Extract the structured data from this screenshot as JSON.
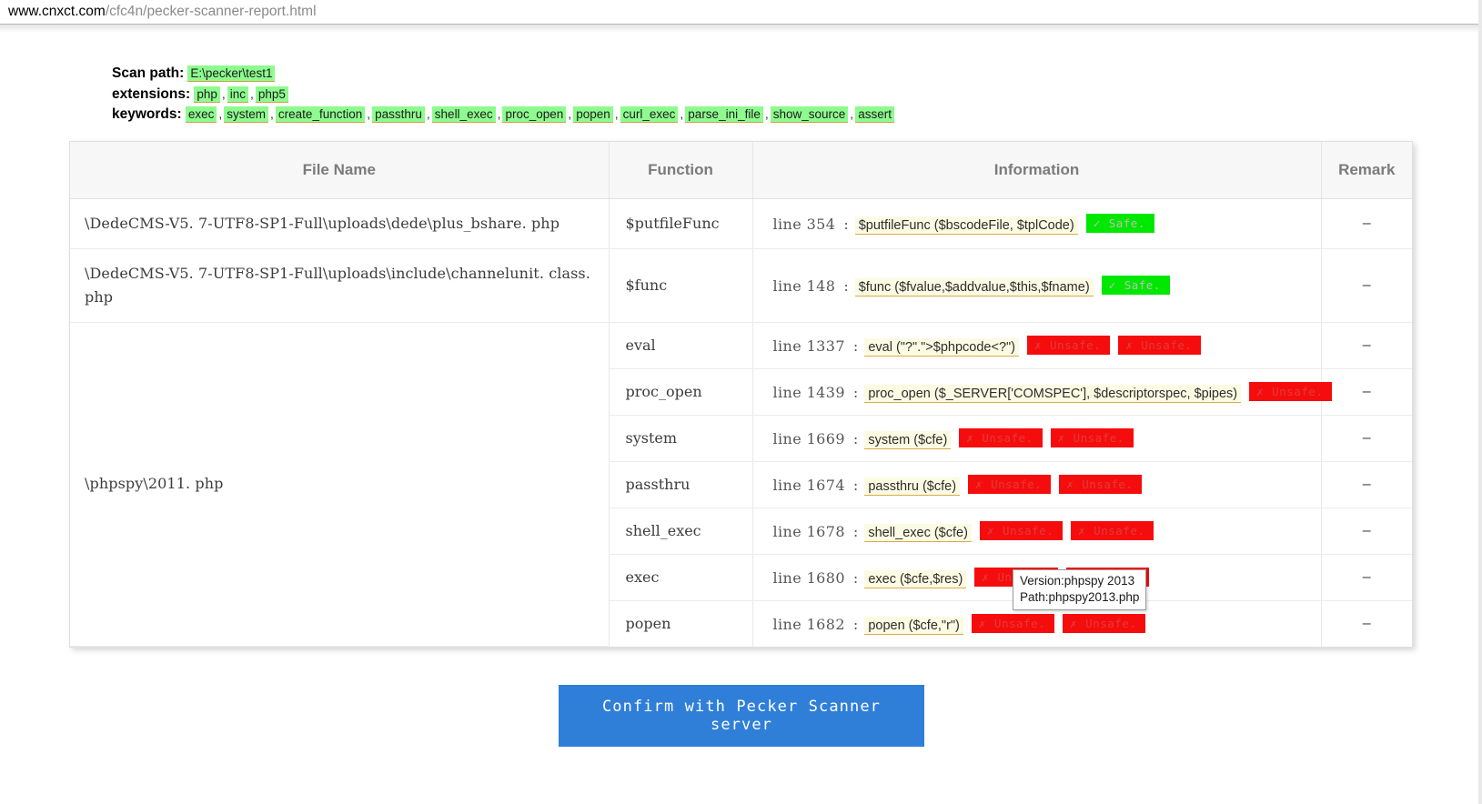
{
  "browser": {
    "url_host": "www.cnxct.com",
    "url_path": "/cfc4n/pecker-scanner-report.html"
  },
  "scan_info": {
    "scan_path_label": "Scan path:",
    "scan_path_value": "E:\\pecker\\test1",
    "extensions_label": "extensions:",
    "extensions": [
      "php",
      "inc",
      "php5"
    ],
    "keywords_label": "keywords:",
    "keywords": [
      "exec",
      "system",
      "create_function",
      "passthru",
      "shell_exec",
      "proc_open",
      "popen",
      "curl_exec",
      "parse_ini_file",
      "show_source",
      "assert"
    ]
  },
  "table": {
    "headers": {
      "file_name": "File Name",
      "function": "Function",
      "information": "Information",
      "remark": "Remark"
    },
    "line_prefix": "line",
    "colon": ":",
    "remark_value": "–",
    "rows": [
      {
        "file": "\\DedeCMS-V5. 7-UTF8-SP1-Full\\uploads\\dede\\plus_bshare. php",
        "function": "$putfileFunc",
        "line": "354",
        "snippet": "$putfileFunc ($bscodeFile, $tplCode)",
        "badges": [
          {
            "mark": "✓",
            "label": "Safe.",
            "state": "safe"
          }
        ],
        "remark": "–"
      },
      {
        "file": "\\DedeCMS-V5. 7-UTF8-SP1-Full\\uploads\\include\\channelunit. class. php",
        "function": "$func",
        "line": "148",
        "snippet": "$func ($fvalue,$addvalue,$this,$fname)",
        "badges": [
          {
            "mark": "✓",
            "label": "Safe.",
            "state": "safe"
          }
        ],
        "remark": "–"
      },
      {
        "file": "\\phpspy\\2011. php",
        "function": "eval",
        "line": "1337",
        "snippet": "eval (\"?\".\">$phpcode<?\")",
        "badges": [
          {
            "mark": "✗",
            "label": "Unsafe.",
            "state": "unsafe"
          },
          {
            "mark": "✗",
            "label": "Unsafe.",
            "state": "unsafe"
          }
        ],
        "remark": "–"
      },
      {
        "file": "",
        "function": "proc_open",
        "line": "1439",
        "snippet": "proc_open ($_SERVER['COMSPEC'], $descriptorspec, $pipes)",
        "badges": [
          {
            "mark": "✗",
            "label": "Unsafe.",
            "state": "unsafe"
          }
        ],
        "remark": "–"
      },
      {
        "file": "",
        "function": "system",
        "line": "1669",
        "snippet": "system ($cfe)",
        "badges": [
          {
            "mark": "✗",
            "label": "Unsafe.",
            "state": "unsafe"
          },
          {
            "mark": "✗",
            "label": "Unsafe.",
            "state": "unsafe"
          }
        ],
        "remark": "–"
      },
      {
        "file": "",
        "function": "passthru",
        "line": "1674",
        "snippet": "passthru ($cfe)",
        "badges": [
          {
            "mark": "✗",
            "label": "Unsafe.",
            "state": "unsafe"
          },
          {
            "mark": "✗",
            "label": "Unsafe.",
            "state": "unsafe"
          }
        ],
        "remark": "–"
      },
      {
        "file": "",
        "function": "shell_exec",
        "line": "1678",
        "snippet": "shell_exec ($cfe)",
        "badges": [
          {
            "mark": "✗",
            "label": "Unsafe.",
            "state": "unsafe"
          },
          {
            "mark": "✗",
            "label": "Unsafe.",
            "state": "unsafe"
          }
        ],
        "remark": "–"
      },
      {
        "file": "",
        "function": "exec",
        "line": "1680",
        "snippet": "exec ($cfe,$res)",
        "badges": [
          {
            "mark": "✗",
            "label": "Unsafe.",
            "state": "unsafe"
          },
          {
            "mark": "✗",
            "label": "Unsafe.",
            "state": "unsafe"
          }
        ],
        "remark": "–"
      },
      {
        "file": "",
        "function": "popen",
        "line": "1682",
        "snippet": "popen ($cfe,\"r\")",
        "badges": [
          {
            "mark": "✗",
            "label": "Unsafe.",
            "state": "unsafe"
          },
          {
            "mark": "✗",
            "label": "Unsafe.",
            "state": "unsafe"
          }
        ],
        "remark": "–"
      }
    ]
  },
  "tooltip": {
    "line1": "Version:phpspy 2013",
    "line2": "Path:phpspy2013.php"
  },
  "footer": {
    "confirm_label": "Confirm with Pecker Scanner server"
  },
  "colors": {
    "keyword_highlight": "#8dfb8d",
    "snippet_bg": "#fbfbe3",
    "safe_badge": "#00e800",
    "unsafe_badge": "#f50d0d",
    "button_blue": "#2f7ed8"
  }
}
